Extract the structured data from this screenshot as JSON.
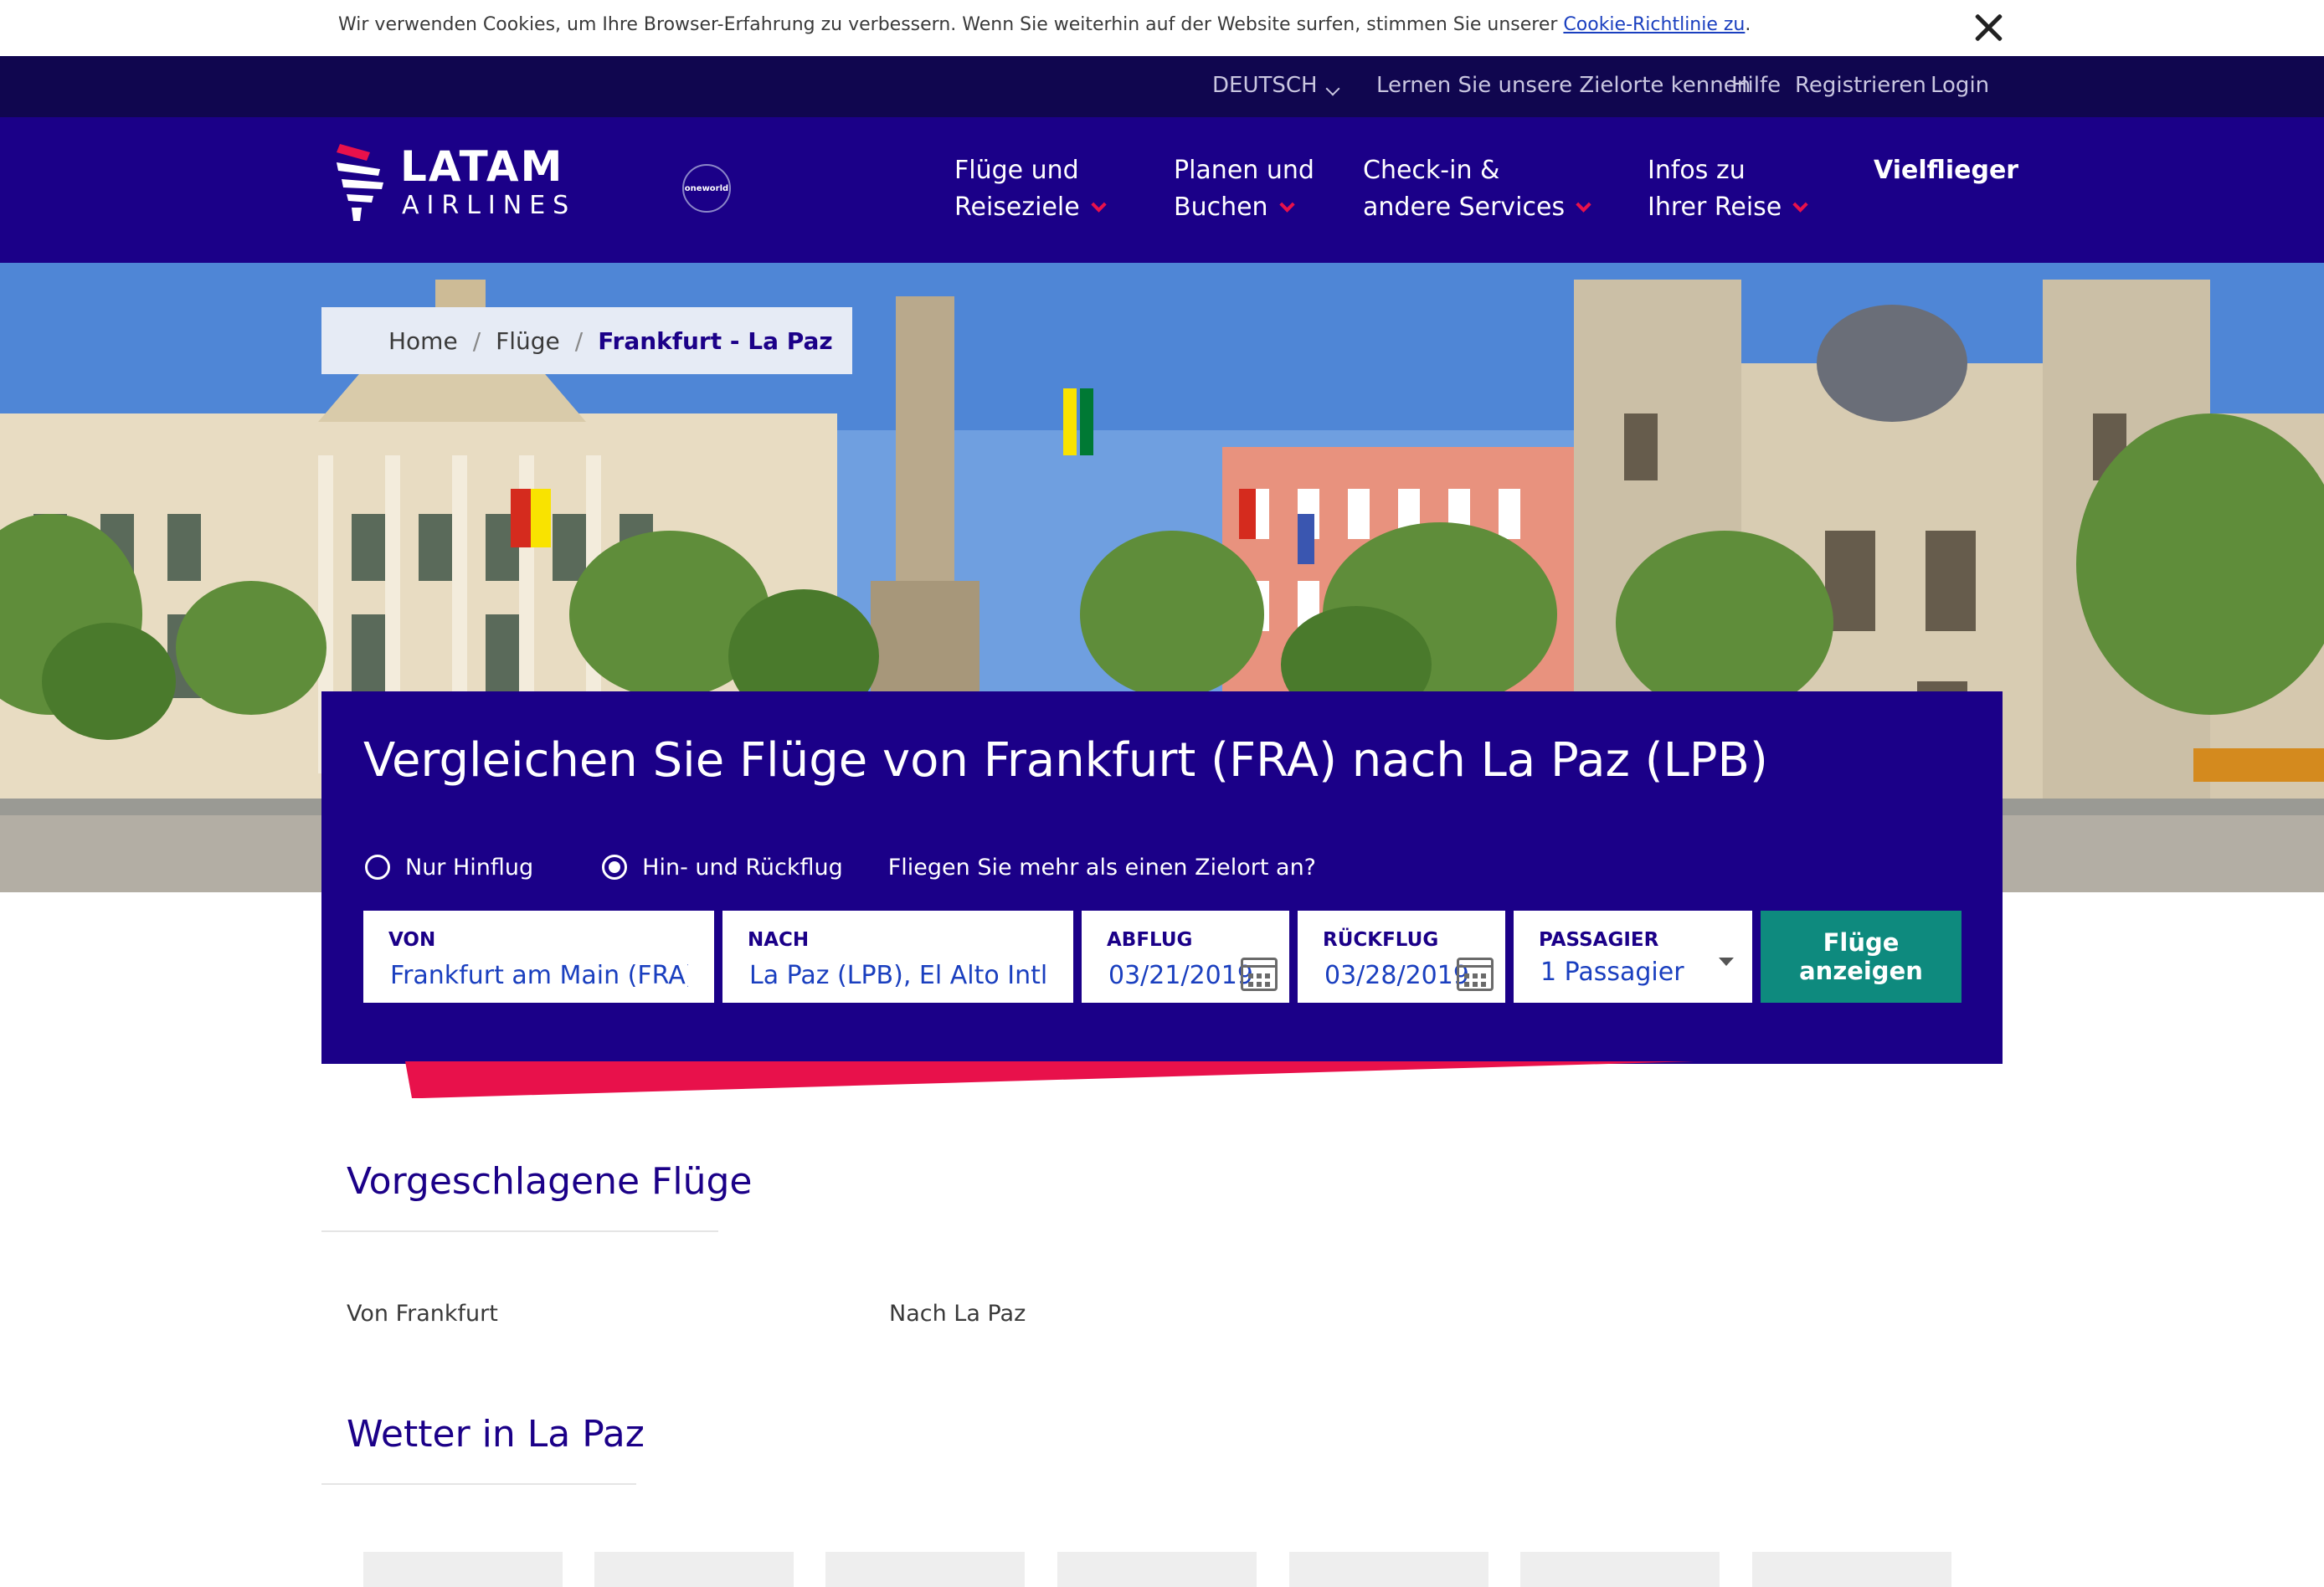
{
  "cookie": {
    "text": "Wir verwenden Cookies, um Ihre Browser-Erfahrung zu verbessern. Wenn Sie weiterhin auf der Website surfen, stimmen Sie unserer ",
    "link": "Cookie-Richtlinie zu",
    "suffix": "."
  },
  "topbar": {
    "language": "DEUTSCH",
    "links": [
      "Lernen Sie unsere Zielorte kennen",
      "Hilfe",
      "Registrieren",
      "Login"
    ]
  },
  "logo": {
    "brand": "LATAM",
    "sub": "AIRLINES",
    "alliance": "oneworld"
  },
  "nav": [
    {
      "line1": "Flüge und",
      "line2": "Reiseziele"
    },
    {
      "line1": "Planen und",
      "line2": "Buchen"
    },
    {
      "line1": "Check-in &",
      "line2": "andere Services"
    },
    {
      "line1": "Infos zu",
      "line2": "Ihrer Reise"
    },
    {
      "line1": "Vielflieger",
      "line2": ""
    }
  ],
  "breadcrumb": {
    "home": "Home",
    "flights": "Flüge",
    "current": "Frankfurt - La Paz"
  },
  "search": {
    "title": "Vergleichen Sie Flüge von Frankfurt (FRA) nach La Paz (LPB)",
    "one_way": "Nur Hinflug",
    "round_trip": "Hin- und Rückflug",
    "multi_city": "Fliegen Sie mehr als einen Zielort an?",
    "from_label": "VON",
    "from_value": "Frankfurt am Main (FRA), F",
    "to_label": "NACH",
    "to_value": "La Paz (LPB), El Alto Intl. (I",
    "depart_label": "ABFLUG",
    "depart_value": "03/21/2019",
    "return_label": "RÜCKFLUG",
    "return_value": "03/28/2019",
    "pax_label": "PASSAGIER",
    "pax_value": "1 Passagier",
    "button": "Flüge anzeigen"
  },
  "suggested": {
    "title": "Vorgeschlagene Flüge",
    "from": "Von Frankfurt",
    "to": "Nach La Paz"
  },
  "weather": {
    "title": "Wetter in La Paz"
  },
  "colors": {
    "nav": "#1b0088",
    "topbar": "#10064f",
    "accent": "#e8114b",
    "button": "#0e8a7e"
  }
}
